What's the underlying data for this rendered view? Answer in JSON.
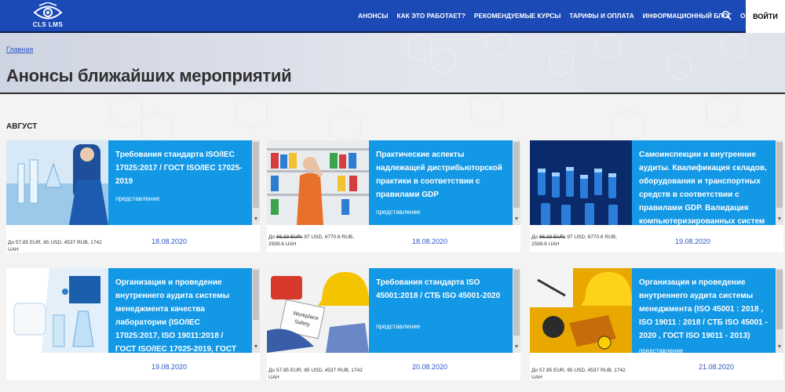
{
  "header": {
    "logo_text": "CLS LMS",
    "nav": [
      "АНОНСЫ",
      "КАК ЭТО РАБОТАЕТ?",
      "РЕКОМЕНДУЕМЫЕ КУРСЫ",
      "ТАРИФЫ И ОПЛАТА",
      "ИНФОРМАЦИОННЫЙ БЛОГ",
      "О НАС"
    ],
    "login_label": "ВОЙТИ",
    "icons": {
      "search": "search-icon",
      "logo": "cls-lms-logo"
    }
  },
  "breadcrumb": "Главная",
  "page_title": "Анонсы ближайших мероприятий",
  "month": "АВГУСТ",
  "colors": {
    "header_bg": "#1b49b5",
    "card_blue": "#1398e6",
    "date_link": "#2a56c6"
  },
  "cards": [
    {
      "title": "Требования стандарта ISO/IEC 17025:2017 / ГОСТ ISO/IEC 17025-2019",
      "type": "представление",
      "price": "До 57.85 EUR, 65 USD, 4537 RUB, 1742 UAH",
      "price_old": "",
      "date": "18.08.2020"
    },
    {
      "title": "Практические аспекты надлежащей дистрибьюторской практики в соответствии с правилами GDP",
      "type": "представление",
      "price": "97 USD, 6770.6 RUB, 2599.6 UAH",
      "price_old": "86.33 EUR;",
      "date": "18.08.2020"
    },
    {
      "title": "Самоинспекции и внутренние аудиты. Квалификация складов, оборудования и транспортных средств в соответствии с правилами GDP. Валидация компьютеризированных систем",
      "type": "",
      "price": "97 USD, 6770.6 RUB, 2599.6 UAH",
      "price_old": "86.33 EUR;",
      "date": "19.08.2020"
    },
    {
      "title": "Организация и проведение внутреннего аудита системы менеджмента качества лаборатории (ISO/IEC 17025:2017, ISO 19011:2018 / ГОСТ ISO/IEC 17025-2019, ГОСТ",
      "type": "",
      "price": "",
      "price_old": "",
      "date": "19.08.2020"
    },
    {
      "title": "Требования стандарта ISO 45001:2018 / СТБ ISO 45001-2020",
      "type": "представление",
      "price": "57.85 EUR, 65 USD, 4537 RUB, 1742 UAH",
      "price_old": "",
      "date": "20.08.2020"
    },
    {
      "title": "Организация и проведение внутреннего аудита системы менеджмента (ISO 45001 : 2018 , ISO 19011 : 2018 / СТБ ISO 45001 - 2020 , ГОСТ ISO 19011 - 2013)",
      "type": "представление",
      "price": "57.85 EUR, 65 USD, 4537 RUB, 1742 UAH",
      "price_old": "",
      "date": "21.08.2020"
    }
  ]
}
